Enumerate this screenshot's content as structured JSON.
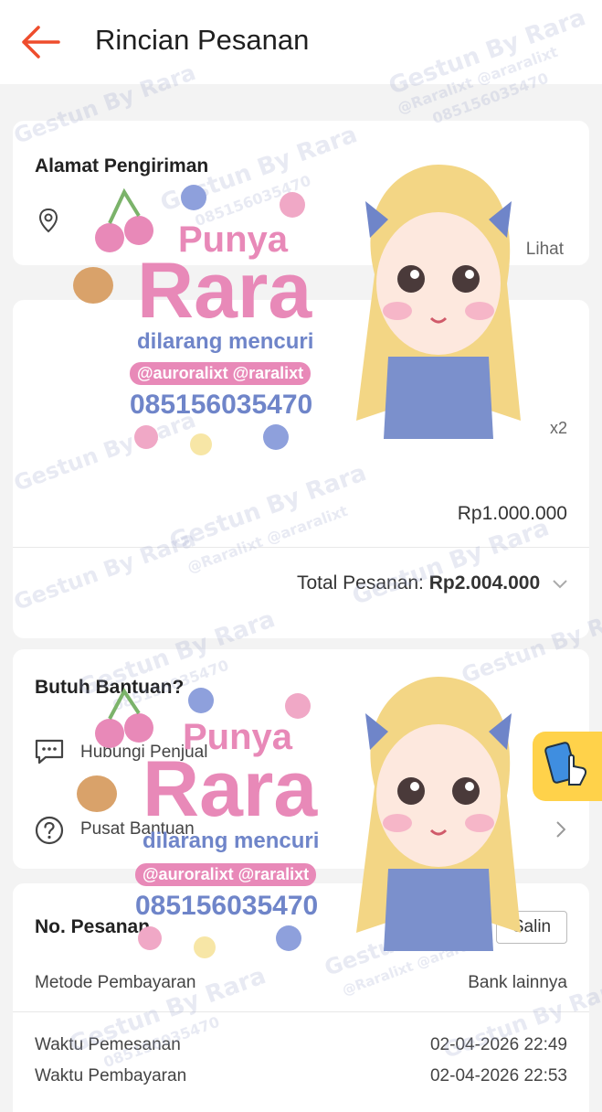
{
  "header": {
    "title": "Rincian Pesanan"
  },
  "address": {
    "title": "Alamat Pengiriman",
    "view_label": "Lihat"
  },
  "product": {
    "qty": "x2",
    "subtotal": "Rp1.000.000"
  },
  "order_total": {
    "label": "Total Pesanan:",
    "value": "Rp2.004.000"
  },
  "help": {
    "title": "Butuh Bantuan?",
    "items": [
      {
        "label": "Hubungi Penjual"
      },
      {
        "label": "Pusat Bantuan"
      }
    ]
  },
  "order_info": {
    "title": "No. Pesanan",
    "copy_label": "Salin",
    "rows": [
      {
        "label": "Metode Pembayaran",
        "value": "Bank lainnya"
      },
      {
        "label": "Waktu Pemesanan",
        "value": "02-04-2026 22:49"
      },
      {
        "label": "Waktu Pembayaran",
        "value": "02-04-2026 22:53"
      }
    ]
  },
  "watermark": {
    "brand": "Gestun By Rara",
    "handles": "@Raralixt @araralixt",
    "phone": "085156035470",
    "sticker_title": "Punya",
    "sticker_name": "Rara",
    "sticker_warning": "dilarang mencuri",
    "sticker_handles": "@auroralixt @raralixt"
  },
  "colors": {
    "accent": "#ee4d2d",
    "brand_pink": "#e889b8",
    "brand_blue": "#6f85c9"
  }
}
